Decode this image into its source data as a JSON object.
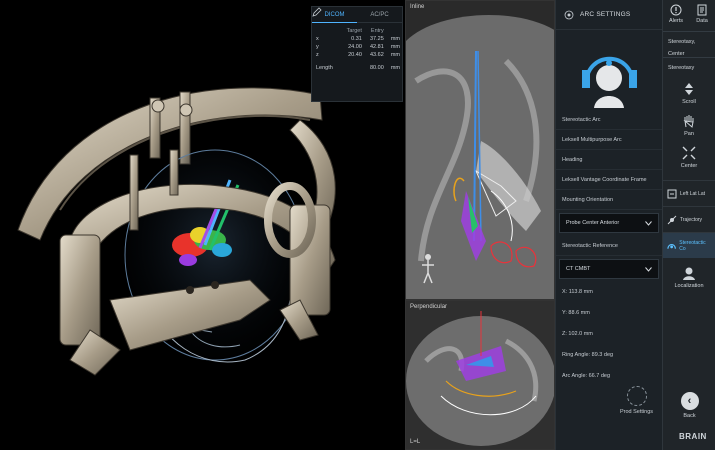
{
  "coord_panel": {
    "tabs": [
      "DICOM",
      "AC/PC"
    ],
    "active_tab": "DICOM",
    "columns": [
      "Target",
      "Entry"
    ],
    "rows": [
      {
        "axis": "x",
        "target": "0.31",
        "entry": "37.25",
        "unit": "mm"
      },
      {
        "axis": "y",
        "target": "24.00",
        "entry": "42.81",
        "unit": "mm"
      },
      {
        "axis": "z",
        "target": "20.40",
        "entry": "43.62",
        "unit": "mm"
      }
    ],
    "length": {
      "label": "Length",
      "value": "80.00",
      "unit": "mm"
    }
  },
  "slices": {
    "inline_label": "Inline",
    "perp_label": "Perpendicular",
    "perp_corner": "L=L"
  },
  "arc_panel": {
    "title": "ARC SETTINGS",
    "fields": {
      "stereotactic_arc": "Stereotactic Arc",
      "lateral_arc": "Leksell Multipurpose Arc",
      "heading": "Heading",
      "lateral_frame": "Leksell Vantage Coordinate Frame",
      "mounting_orientation": "Mounting Orientation"
    },
    "mounting_select": "Probe Center Anterior",
    "stereotactic_reference_label": "Stereotactic Reference",
    "reference_select": "CT CMBT",
    "values": {
      "x": "X: 113.8  mm",
      "y": "Y: 88.6  mm",
      "z": "Z: 102.0  mm",
      "ring": "Ring Angle: 89.3  deg",
      "arc": "Arc Angle: 66.7  deg"
    },
    "prod_settings": "Prod Settings"
  },
  "toolbar": {
    "alerts": "Alerts",
    "data": "Data",
    "breadcrumb": "Stereotaxy, Center",
    "section": "Stereotaxy",
    "scroll": "Scroll",
    "pan": "Pan",
    "center": "Center",
    "left_lat": "Left Lat Lat",
    "trajectory": "Trajectory",
    "stereotactic": "Stereotactic Co",
    "localization": "Localization",
    "back": "Back",
    "brand": "BRAIN"
  },
  "colors": {
    "accent": "#4fb4ff",
    "panel": "#1c2227",
    "toolbar": "#202529"
  }
}
